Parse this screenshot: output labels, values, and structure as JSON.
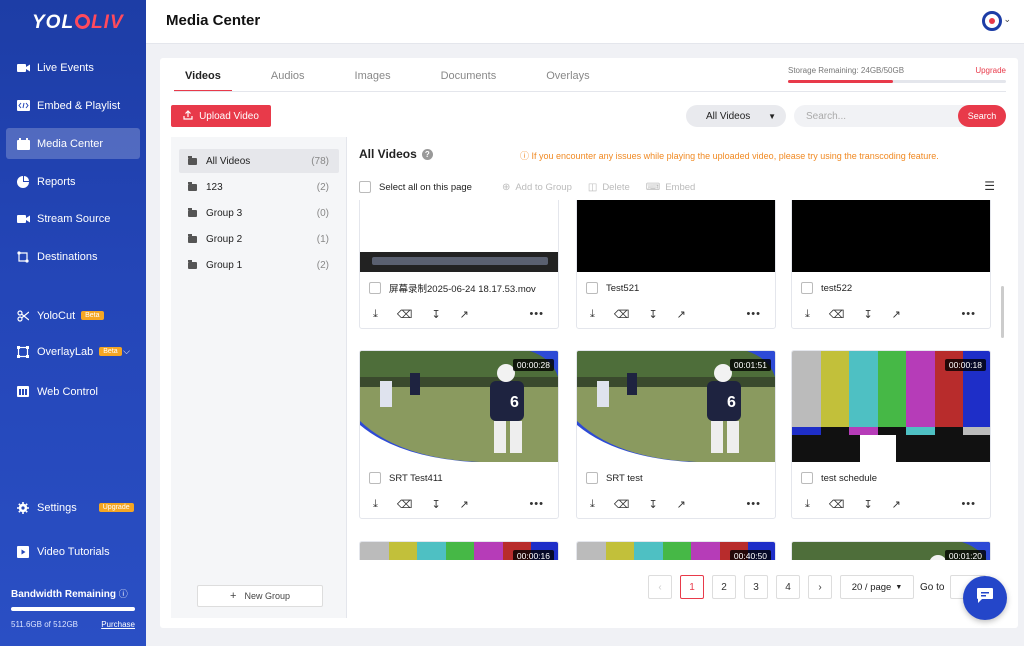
{
  "app": {
    "logo_left": "YOL",
    "logo_right": "LIV",
    "page_title": "Media Center"
  },
  "sidebar": {
    "items": [
      {
        "label": "Live Events",
        "icon": "video-camera-icon"
      },
      {
        "label": "Embed & Playlist",
        "icon": "code-icon"
      },
      {
        "label": "Media Center",
        "icon": "folder-calendar-icon"
      },
      {
        "label": "Reports",
        "icon": "pie-chart-icon"
      },
      {
        "label": "Stream Source",
        "icon": "video-camera-icon"
      },
      {
        "label": "Destinations",
        "icon": "route-icon"
      },
      {
        "label": "YoloCut",
        "icon": "scissors-icon",
        "badge": "Beta"
      },
      {
        "label": "OverlayLab",
        "icon": "overlay-icon",
        "badge": "Beta"
      },
      {
        "label": "Web Control",
        "icon": "web-control-icon"
      },
      {
        "label": "Settings",
        "icon": "gear-icon",
        "badge": "Upgrade"
      },
      {
        "label": "Video Tutorials",
        "icon": "play-icon"
      }
    ],
    "bandwidth": {
      "title": "Bandwidth Remaining",
      "usage": "511.6GB of 512GB",
      "fraction": 0.999,
      "purchase": "Purchase"
    }
  },
  "tabs": [
    "Videos",
    "Audios",
    "Images",
    "Documents",
    "Overlays"
  ],
  "storage": {
    "text": "Storage Remaining: 24GB/50GB",
    "upgrade": "Upgrade",
    "fraction": 0.48
  },
  "toolbar": {
    "upload": "Upload Video",
    "filter": "All Videos",
    "search_placeholder": "Search...",
    "search_btn": "Search"
  },
  "groups": {
    "items": [
      {
        "label": "All Videos",
        "count": "(78)"
      },
      {
        "label": "123",
        "count": "(2)"
      },
      {
        "label": "Group 3",
        "count": "(0)"
      },
      {
        "label": "Group 2",
        "count": "(1)"
      },
      {
        "label": "Group 1",
        "count": "(2)"
      }
    ],
    "new_group": "New Group"
  },
  "grid": {
    "title": "All Videos",
    "warning": "If you encounter any issues while playing the uploaded video, please try using the transcoding feature.",
    "select_all": "Select all on this page",
    "actions": [
      "Add to Group",
      "Delete",
      "Embed"
    ]
  },
  "videos": [
    {
      "name": "屏幕录制2025-06-24 18.17.53.mov",
      "duration": ""
    },
    {
      "name": "Test521",
      "duration": ""
    },
    {
      "name": "test522",
      "duration": ""
    },
    {
      "name": "SRT Test411",
      "duration": "00:00:28"
    },
    {
      "name": "SRT test",
      "duration": "00:01:51"
    },
    {
      "name": "test schedule",
      "duration": "00:00:18"
    },
    {
      "name": "",
      "duration": "00:00:16"
    },
    {
      "name": "",
      "duration": "00:40:50"
    },
    {
      "name": "",
      "duration": "00:01:20"
    }
  ],
  "pagination": {
    "pages": [
      "1",
      "2",
      "3",
      "4"
    ],
    "current": "1",
    "per_page": "20 / page",
    "goto": "Go to"
  },
  "colors": {
    "accent": "#e83a4a",
    "sidebar": "#2446b8",
    "warning": "#f08a24"
  }
}
